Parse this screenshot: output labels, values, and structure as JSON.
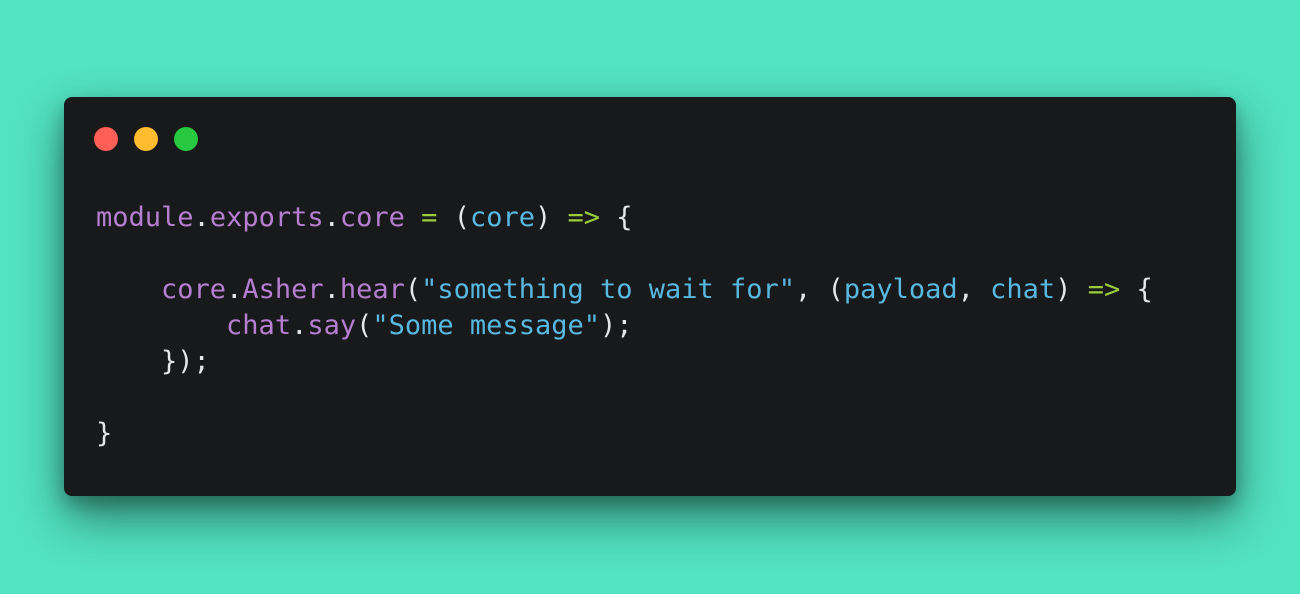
{
  "window": {
    "controls": [
      {
        "name": "close",
        "color": "#ff5f57"
      },
      {
        "name": "minimize",
        "color": "#febc2e"
      },
      {
        "name": "maximize",
        "color": "#28c840"
      }
    ]
  },
  "theme": {
    "background": "#52e3c2",
    "editor_bg": "#17191b",
    "keyword": "#b57ed0",
    "identifier": "#58b8e0",
    "operator": "#9ccc3c",
    "punctuation": "#e6e6e6",
    "string": "#58b8e0"
  },
  "code": {
    "lines": [
      [
        {
          "t": "module",
          "k": "keyword"
        },
        {
          "t": ".",
          "k": "punctuation"
        },
        {
          "t": "exports",
          "k": "keyword"
        },
        {
          "t": ".",
          "k": "punctuation"
        },
        {
          "t": "core",
          "k": "keyword"
        },
        {
          "t": " ",
          "k": "punctuation"
        },
        {
          "t": "=",
          "k": "operator"
        },
        {
          "t": " (",
          "k": "punctuation"
        },
        {
          "t": "core",
          "k": "identifier"
        },
        {
          "t": ") ",
          "k": "punctuation"
        },
        {
          "t": "=>",
          "k": "operator"
        },
        {
          "t": " {",
          "k": "punctuation"
        }
      ],
      [],
      [
        {
          "t": "    ",
          "k": "punctuation"
        },
        {
          "t": "core",
          "k": "keyword"
        },
        {
          "t": ".",
          "k": "punctuation"
        },
        {
          "t": "Asher",
          "k": "keyword"
        },
        {
          "t": ".",
          "k": "punctuation"
        },
        {
          "t": "hear",
          "k": "keyword"
        },
        {
          "t": "(",
          "k": "punctuation"
        },
        {
          "t": "\"something to wait for\"",
          "k": "string"
        },
        {
          "t": ", (",
          "k": "punctuation"
        },
        {
          "t": "payload",
          "k": "identifier"
        },
        {
          "t": ", ",
          "k": "punctuation"
        },
        {
          "t": "chat",
          "k": "identifier"
        },
        {
          "t": ") ",
          "k": "punctuation"
        },
        {
          "t": "=>",
          "k": "operator"
        },
        {
          "t": " {",
          "k": "punctuation"
        }
      ],
      [
        {
          "t": "        ",
          "k": "punctuation"
        },
        {
          "t": "chat",
          "k": "keyword"
        },
        {
          "t": ".",
          "k": "punctuation"
        },
        {
          "t": "say",
          "k": "keyword"
        },
        {
          "t": "(",
          "k": "punctuation"
        },
        {
          "t": "\"Some message\"",
          "k": "string"
        },
        {
          "t": ");",
          "k": "punctuation"
        }
      ],
      [
        {
          "t": "    ",
          "k": "punctuation"
        },
        {
          "t": "});",
          "k": "punctuation"
        }
      ],
      [],
      [
        {
          "t": "}",
          "k": "punctuation"
        }
      ]
    ]
  }
}
